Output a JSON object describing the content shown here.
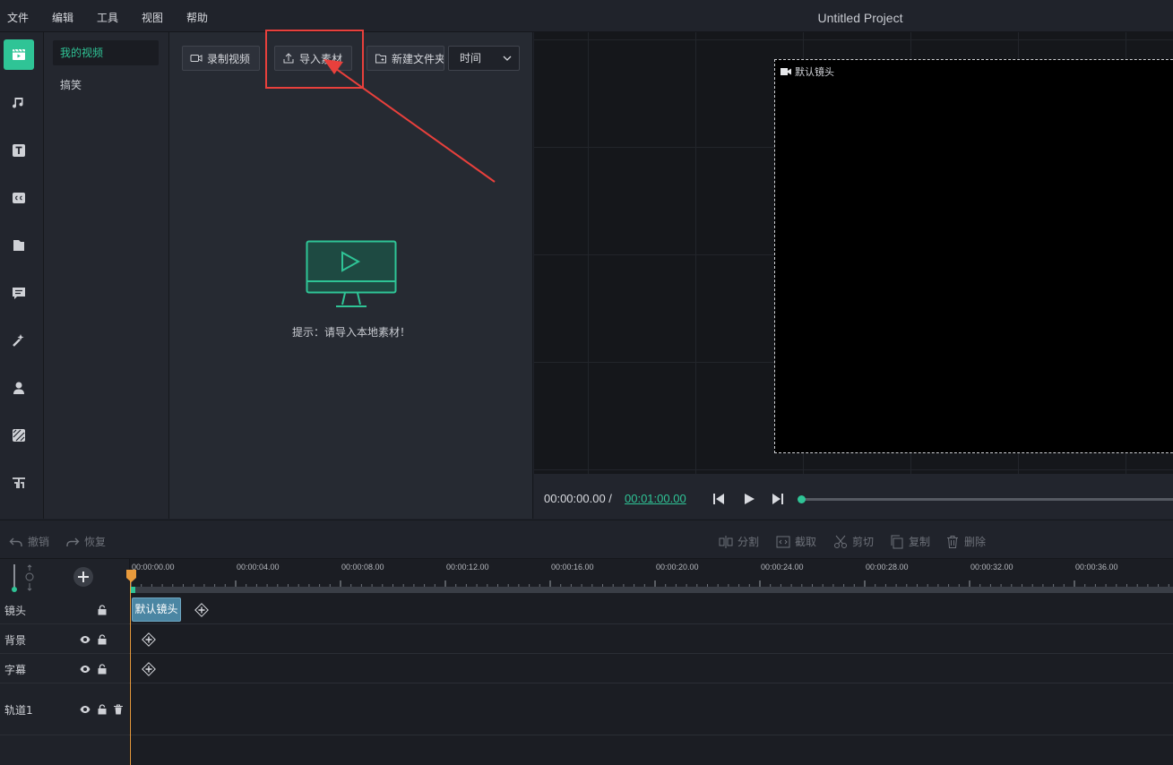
{
  "menu": [
    "文件",
    "编辑",
    "工具",
    "视图",
    "帮助"
  ],
  "window_title": "Untitled Project",
  "sidebar_icons": [
    "media-icon",
    "music-icon",
    "text-icon",
    "caption-icon",
    "folder-icon",
    "message-icon",
    "effects-icon",
    "avatar-icon",
    "filter-icon",
    "transition-icon"
  ],
  "categories": [
    {
      "label": "我的视频",
      "active": true
    },
    {
      "label": "搞笑",
      "active": false
    }
  ],
  "toolbar": {
    "record_label": "录制视频",
    "import_label": "导入素材",
    "new_folder_label": "新建文件夹",
    "sort_value": "时间"
  },
  "empty_hint": "提示：请导入本地素材！",
  "preview": {
    "stage_label": "默认镜头",
    "time_current": "00:00:00.00 /",
    "time_total": "00:01:00.00",
    "progress": 0
  },
  "timeline_tools": {
    "undo": "撤销",
    "redo": "恢复",
    "split": "分割",
    "crop": "截取",
    "cut": "剪切",
    "copy": "复制",
    "delete": "删除"
  },
  "ruler_ticks": [
    "00:00:00.00",
    "00:00:04.00",
    "00:00:08.00",
    "00:00:12.00",
    "00:00:16.00",
    "00:00:20.00",
    "00:00:24.00",
    "00:00:28.00",
    "00:00:32.00",
    "00:00:36.00"
  ],
  "tracks": [
    {
      "name": "镜头"
    },
    {
      "name": "背景"
    },
    {
      "name": "字幕"
    },
    {
      "name": "轨道1"
    }
  ],
  "clip_label": "默认镜头",
  "colors": {
    "accent": "#2fc496",
    "highlight": "#e8403c",
    "playhead": "#e89a3c",
    "clip": "#4b86a3"
  }
}
